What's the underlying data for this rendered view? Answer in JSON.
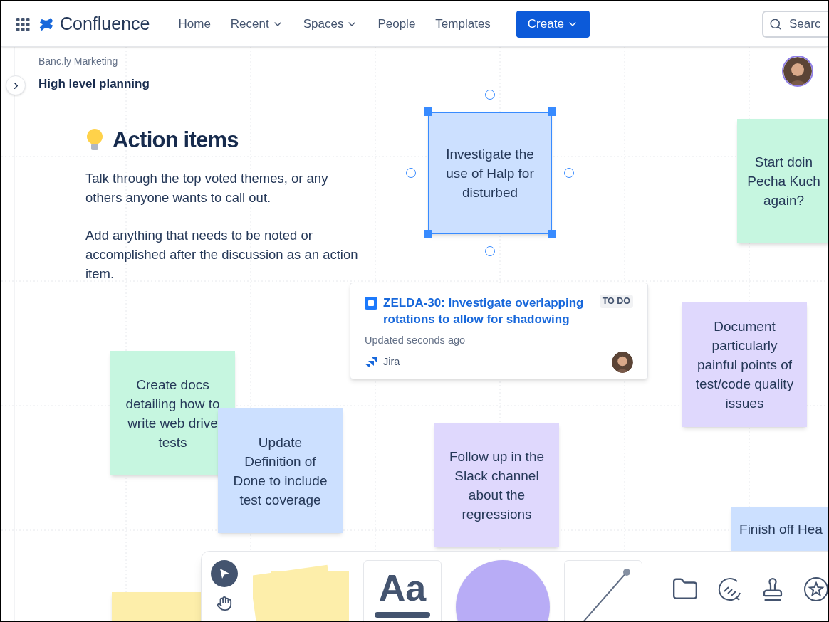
{
  "nav": {
    "product": "Confluence",
    "items": [
      {
        "label": "Home",
        "dropdown": false
      },
      {
        "label": "Recent",
        "dropdown": true
      },
      {
        "label": "Spaces",
        "dropdown": true
      },
      {
        "label": "People",
        "dropdown": false
      },
      {
        "label": "Templates",
        "dropdown": false
      }
    ],
    "create": "Create",
    "search": {
      "placeholder": "Searc"
    }
  },
  "breadcrumb": {
    "space": "Banc.ly Marketing",
    "page": "High level planning"
  },
  "intro": {
    "heading": "Action items",
    "paragraphs": [
      "Talk through the top voted themes, or any others anyone wants to call out.",
      "Add anything that needs to be noted or accomplished after the discussion as an action item."
    ]
  },
  "stickies": [
    {
      "lines": [
        "Investigate the",
        "use of Halp for",
        "disturbed"
      ],
      "color": "#cce0ff",
      "selected": true
    },
    {
      "lines": [
        "Start doin",
        "Pecha Kuch",
        "again?"
      ],
      "color": "#c6f6e0",
      "selected": false
    },
    {
      "lines": [
        "Document",
        "particularly",
        "painful points of",
        "test/code quality",
        "issues"
      ],
      "color": "#dfd8fd",
      "selected": false
    },
    {
      "lines": [
        "Create docs",
        "detailing how to",
        "write web drive",
        "tests"
      ],
      "color": "#c6f6e0",
      "selected": false
    },
    {
      "lines": [
        "Update",
        "Definition of",
        "Done to include",
        "test coverage"
      ],
      "color": "#cce0ff",
      "selected": false
    },
    {
      "lines": [
        "Follow up in the",
        "Slack channel",
        "about the",
        "regressions"
      ],
      "color": "#dfd8fd",
      "selected": false
    },
    {
      "lines": [
        "Finish off Hea"
      ],
      "color": "#cce0ff",
      "selected": false
    },
    {
      "color": "#fdeeaa",
      "selected": false
    }
  ],
  "jira_card": {
    "title": "ZELDA-30: Investigate overlapping rotations to allow for shadowing",
    "status": "TO DO",
    "updated": "Updated seconds ago",
    "source": "Jira"
  },
  "toolbar": {
    "tools": [
      {
        "kind": "select",
        "selected": true
      },
      {
        "kind": "hand",
        "selected": false
      }
    ],
    "text_sample": "Aa"
  }
}
